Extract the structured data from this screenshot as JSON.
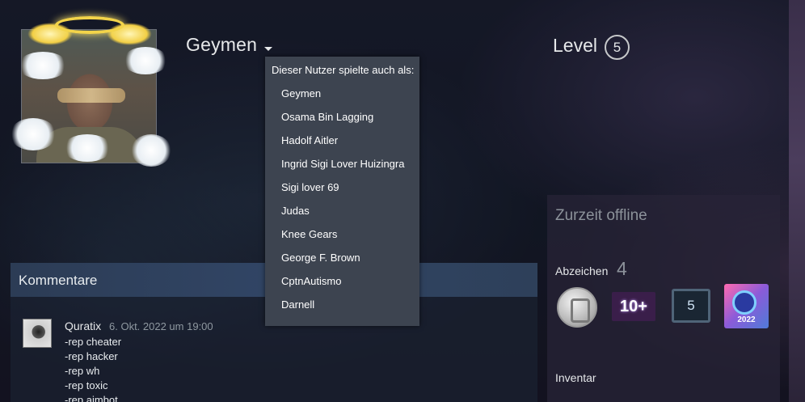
{
  "profile": {
    "persona_name": "Geymen",
    "level_label": "Level",
    "level_value": "5"
  },
  "aliases_menu": {
    "header": "Dieser Nutzer spielte auch als:",
    "items": [
      "Geymen",
      "Osama Bin Lagging",
      "Hadolf Aitler",
      "Ingrid Sigi Lover Huizingra",
      "Sigi lover 69",
      "Judas",
      "Knee Gears",
      "George F. Brown",
      "CptnAutismo",
      "Darnell"
    ]
  },
  "comments": {
    "title": "Kommentare",
    "first": {
      "author": "Quratix",
      "date": "6. Okt. 2022 um 19:00",
      "lines": [
        "-rep cheater",
        "-rep hacker",
        "-rep wh",
        "-rep toxic",
        "-rep aimbot"
      ]
    }
  },
  "sidebar": {
    "status": "Zurzeit offline",
    "badges_label": "Abzeichen",
    "badges_count": "4",
    "badges": [
      {
        "icon": "silver-coin-badge-icon",
        "text": ""
      },
      {
        "icon": "years-of-service-badge-icon",
        "text": "10+"
      },
      {
        "icon": "level-screen-badge-icon",
        "text": "5"
      },
      {
        "icon": "steam-2022-badge-icon",
        "text": "2022"
      }
    ],
    "inventory_label": "Inventar"
  }
}
